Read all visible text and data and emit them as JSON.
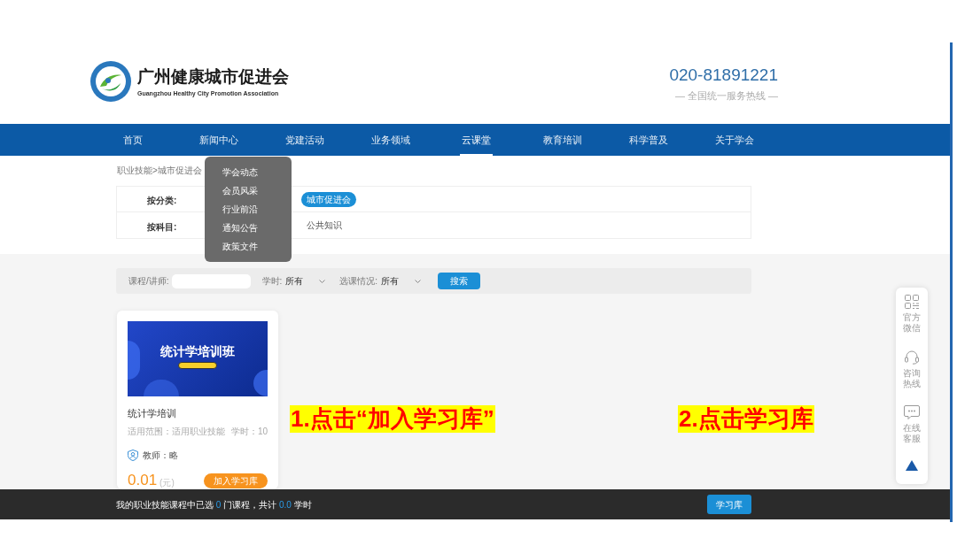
{
  "header": {
    "title": "广州健康城市促进会",
    "subtitle": "Guangzhou Healthy City Promotion Association",
    "phone": "020-81891221",
    "phone_caption": "— 全国统一服务热线 —"
  },
  "nav": [
    {
      "label": "首页",
      "selected": false
    },
    {
      "label": "新闻中心",
      "selected": false,
      "menu": [
        "学会动态",
        "会员风采",
        "行业前沿",
        "通知公告",
        "政策文件"
      ]
    },
    {
      "label": "党建活动",
      "selected": false
    },
    {
      "label": "业务领域",
      "selected": false
    },
    {
      "label": "云课堂",
      "selected": true
    },
    {
      "label": "教育培训",
      "selected": false
    },
    {
      "label": "科学普及",
      "selected": false
    },
    {
      "label": "关于学会",
      "selected": false
    }
  ],
  "breadcrumb": "职业技能>城市促进会",
  "filters": [
    {
      "label": "按分类:",
      "options": [
        {
          "label": "城市促进会",
          "selected": true
        }
      ]
    },
    {
      "label": "按科目:",
      "options": [
        {
          "label": "公共知识",
          "selected": false
        }
      ]
    }
  ],
  "search": {
    "fields": [
      {
        "kind": "text",
        "label": "课程/讲师:"
      },
      {
        "kind": "select",
        "label": "学时:",
        "value": "所有"
      },
      {
        "kind": "select",
        "label": "选课情况:",
        "value": "所有"
      }
    ],
    "button": "搜索"
  },
  "courses": [
    {
      "banner_title": "统计学培训班",
      "title": "统计学培训",
      "scope": "适用范围：适用职业技能",
      "hours": "学时：10",
      "teacher": "教师：略",
      "price": "0.01",
      "price_unit": "(元)",
      "button": "加入学习库"
    }
  ],
  "annotations": [
    "1.点击“加入学习库”",
    "2.点击学习库"
  ],
  "side_tools": [
    {
      "kind": "qr",
      "label": "官方微信"
    },
    {
      "kind": "headset",
      "label": "咨询热线"
    },
    {
      "kind": "chat",
      "label": "在线客服"
    },
    {
      "kind": "top"
    }
  ],
  "footer_bar": {
    "text_before": "我的职业技能课程中已选",
    "course_count": "0",
    "text_middle": "门课程，共计",
    "hour_count": "0.0",
    "text_after": "学时",
    "button": "学习库"
  }
}
